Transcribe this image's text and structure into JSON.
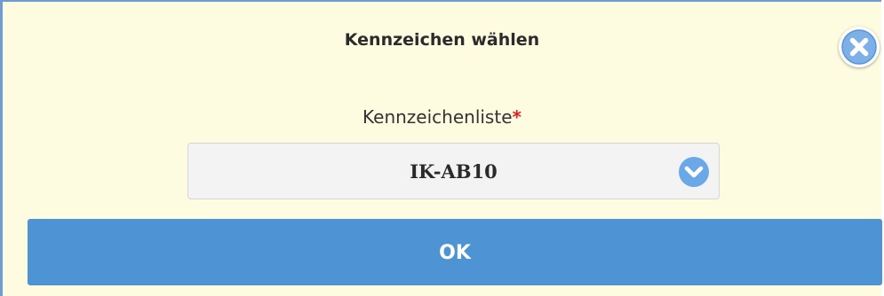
{
  "dialog": {
    "title": "Kennzeichen wählen",
    "close_icon": "close-circle-icon"
  },
  "plate_field": {
    "label": "Kennzeichenliste",
    "required_marker": "*",
    "selected_value": "IK-AB10",
    "dropdown_icon": "chevron-down-circle-icon"
  },
  "ok_button": {
    "label": "OK"
  },
  "colors": {
    "background": "#fdfbe0",
    "accent": "#4e94d4",
    "border": "#6f9bd3",
    "required": "#e02020"
  }
}
